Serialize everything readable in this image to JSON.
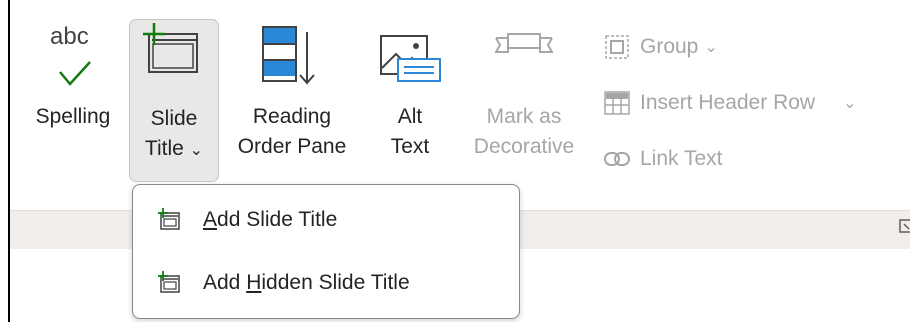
{
  "ribbon": {
    "spelling": {
      "icon_text": "abc",
      "label": "Spelling",
      "icon": "spelling-check-icon"
    },
    "slide_title": {
      "line1": "Slide",
      "line2": "Title",
      "dropdown_glyph": "⌄",
      "icon": "slide-title-add-icon"
    },
    "reading_order": {
      "line1": "Reading",
      "line2": "Order Pane",
      "icon": "reading-order-icon"
    },
    "alt_text": {
      "line1": "Alt",
      "line2": "Text",
      "icon": "alt-text-image-icon"
    },
    "mark_decorative": {
      "line1": "Mark as",
      "line2": "Decorative",
      "enabled": false,
      "icon": "mark-decorative-banner-icon"
    },
    "group": {
      "label": "Group",
      "dropdown_glyph": "⌄",
      "enabled": false,
      "icon": "group-icon"
    },
    "insert_header_row": {
      "label": "Insert Header Row",
      "dropdown_glyph": "⌄",
      "enabled": false,
      "icon": "table-header-icon"
    },
    "link_text": {
      "label": "Link Text",
      "enabled": false,
      "icon": "link-icon"
    }
  },
  "dropdown_menu": {
    "items": [
      {
        "access_key": "A",
        "rest": "dd Slide Title",
        "icon": "slide-title-add-icon"
      },
      {
        "before": "Add ",
        "access_key": "H",
        "rest": "idden Slide Title",
        "icon": "slide-title-add-icon"
      }
    ]
  },
  "colors": {
    "accent_green": "#107c10",
    "disabled_text": "#a8a6a3",
    "selected_button_bg": "#e9e8e7",
    "ribbon_strip": "#f0edea",
    "icon_blue": "#2b88d8"
  }
}
